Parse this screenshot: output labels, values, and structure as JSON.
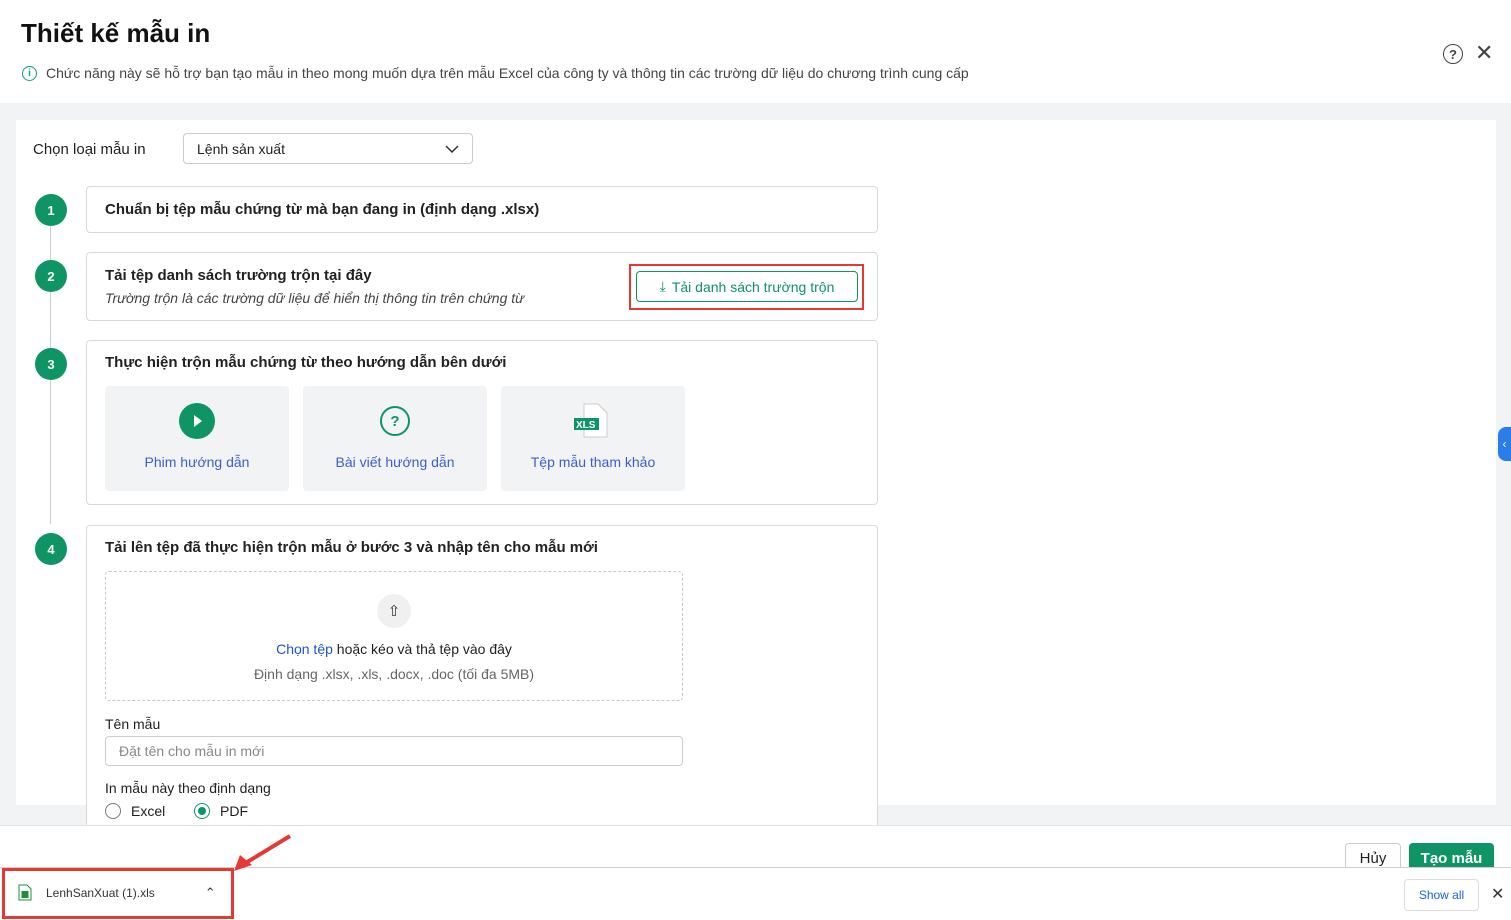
{
  "header": {
    "title": "Thiết kế mẫu in",
    "subtitle": "Chức năng này sẽ hỗ trợ bạn tạo mẫu in theo mong muốn dựa trên mẫu Excel của công ty và thông tin các trường dữ liệu do chương trình cung cấp"
  },
  "type_select": {
    "label": "Chọn loại mẫu in",
    "value": "Lệnh sản xuất"
  },
  "steps": [
    {
      "num": "1",
      "title": "Chuẩn bị tệp mẫu chứng từ mà bạn đang in (định dạng .xlsx)"
    },
    {
      "num": "2",
      "title": "Tải tệp danh sách trường trộn tại đây",
      "desc": "Trường trộn là các trường dữ liệu để hiển thị thông tin trên chứng từ",
      "button": "Tải danh sách trường trộn"
    },
    {
      "num": "3",
      "title": "Thực hiện trộn mẫu chứng từ theo hướng dẫn bên dưới",
      "tiles": [
        {
          "label": "Phim hướng dẫn"
        },
        {
          "label": "Bài viết hướng dẫn"
        },
        {
          "label": "Tệp mẫu tham khảo",
          "badge": "XLS"
        }
      ]
    },
    {
      "num": "4",
      "title": "Tải lên tệp đã thực hiện trộn mẫu ở bước 3 và nhập tên cho mẫu mới",
      "upload_link": "Chọn tệp",
      "upload_text": "hoặc kéo và thả tệp vào đây",
      "upload_hint": "Định dạng .xlsx, .xls, .docx, .doc (tối đa 5MB)",
      "name_label": "Tên mẫu",
      "name_placeholder": "Đặt tên cho mẫu in mới",
      "format_label": "In mẫu này theo định dạng",
      "formats": [
        "Excel",
        "PDF"
      ],
      "selected_format": "PDF"
    }
  ],
  "footer": {
    "cancel": "Hủy",
    "create": "Tạo mẫu"
  },
  "download_bar": {
    "file": "LenhSanXuat (1).xls",
    "show_all": "Show all"
  },
  "colors": {
    "accent": "#0e9465",
    "link": "#3a5fcd",
    "highlight": "#e53935"
  }
}
